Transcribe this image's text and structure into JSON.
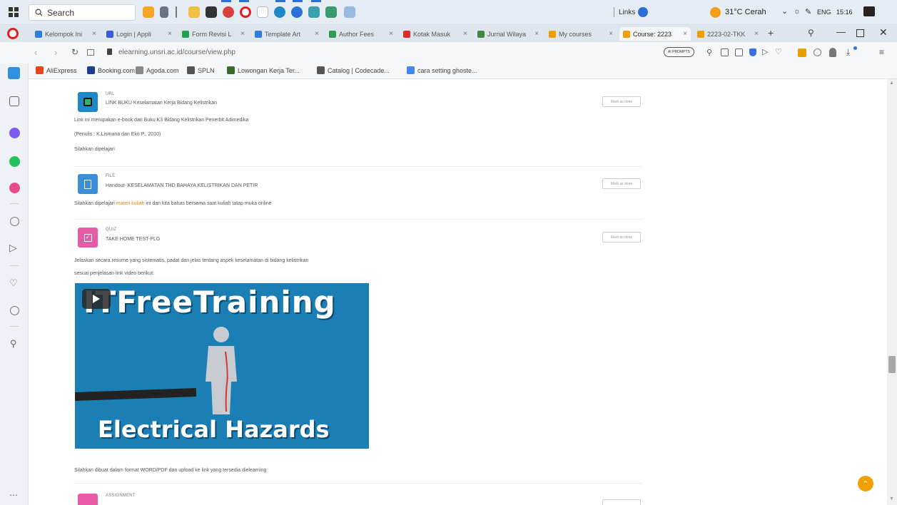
{
  "taskbar": {
    "search_placeholder": "Search",
    "links_label": "Links",
    "weather": "31°C Cerah",
    "lang": "ENG",
    "time": "15:16"
  },
  "tabs": [
    {
      "label": "Kelompok Ini",
      "color": "#2f7de1"
    },
    {
      "label": "Login | Appli",
      "color": "#3b5bdb"
    },
    {
      "label": "Form Revisi L",
      "color": "#20a050"
    },
    {
      "label": "Template Art",
      "color": "#2f7de1"
    },
    {
      "label": "Author Fees",
      "color": "#2e9e4e"
    },
    {
      "label": "Kotak Masuk",
      "color": "#d93025"
    },
    {
      "label": "Jurnal Wilaya",
      "color": "#3a8a3a"
    },
    {
      "label": "My courses",
      "color": "#f0a000"
    },
    {
      "label": "Course: 2223",
      "color": "#f0a000"
    },
    {
      "label": "2223-02-TKK",
      "color": "#f0a000"
    }
  ],
  "address": {
    "url": "elearning.unsri.ac.id/course/view.php",
    "ai_badge": "AI PROMPTS"
  },
  "bookmarks": [
    {
      "label": "AliExpress",
      "color": "#e8451e"
    },
    {
      "label": "Booking.com",
      "color": "#1a3d8f"
    },
    {
      "label": "Agoda.com",
      "color": "#888888"
    },
    {
      "label": "SPLN",
      "color": "#555555"
    },
    {
      "label": "Lowongan Kerja Ter...",
      "color": "#3a6b2a"
    },
    {
      "label": "Catalog | Codecade...",
      "color": "#555555"
    },
    {
      "label": "cara setting ghoste...",
      "color": "#4285f4"
    }
  ],
  "activities": {
    "url": {
      "type": "URL",
      "name": "LINK BUKU Keselamatan Kerja Bidang Kelistrikan",
      "done": "Mark as done"
    },
    "url_desc": [
      "Link ini merupakan e-book dari Buku K3 Bidang Kelistrikan Penerbit Adimedika",
      "(Penulis : K.Lismana dan Eko P., 2010)",
      "Silahkan dipelajari"
    ],
    "file": {
      "type": "FILE",
      "name": "Handout- KESELAMATAN THD BAHAYA KELISTRIKAN DAN PETIR",
      "done": "Mark as done"
    },
    "file_desc_pre": "Silahkan dipelajari ",
    "file_desc_link": "materi kuliah",
    "file_desc_post": " ini dan kita bahas bersama saat kuliah tatap muka online",
    "quiz": {
      "type": "QUIZ",
      "name": "TAKE HOME TEST-PLG",
      "done": "Mark as done"
    },
    "quiz_desc": [
      "Jelaskan secara resume yang sistematis, padat dan jelas tentang aspek keselamatan di bidang kelistrikan",
      "sesuai penjelasan link video berikut:"
    ],
    "video": {
      "title": "ITFreeTraining",
      "subtitle": "Electrical Hazards"
    },
    "quiz_footer": "Silahkan dibuat dalam format WORD/PDF dan upload ke link yang tersedia dielearning",
    "assignment": {
      "type": "ASSIGNMENT"
    }
  },
  "colors": {
    "url_icon": "#1e88c8",
    "file_icon": "#3a8fd8",
    "quiz_icon": "#e85aa8",
    "video_bg": "#1b7fb5",
    "accent": "#f0a000"
  }
}
